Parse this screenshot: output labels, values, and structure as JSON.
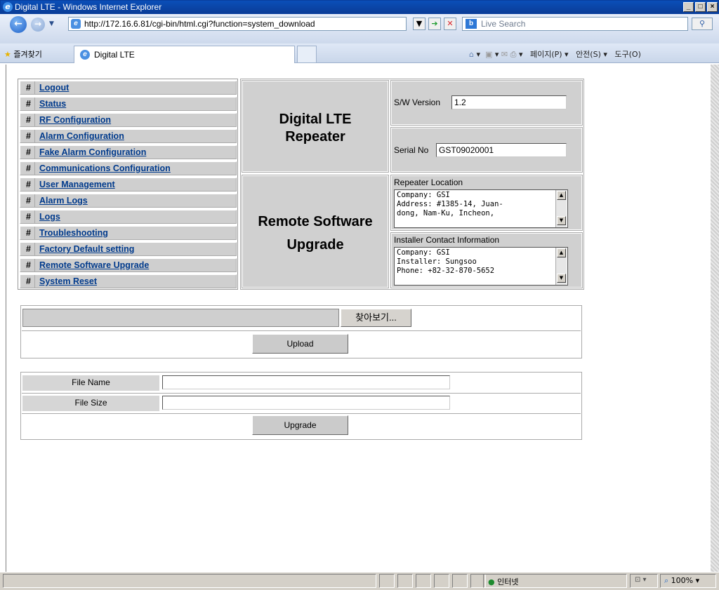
{
  "window": {
    "title": "Digital LTE - Windows Internet Explorer",
    "url": "http://172.16.6.81/cgi-bin/html.cgi?function=system_download",
    "search_placeholder": "Live Search",
    "favorites_label": "즐겨찾기",
    "tab_title": "Digital LTE",
    "toolbar_menus": [
      "페이지(P)",
      "안전(S)",
      "도구(O)"
    ],
    "status_zone": "인터넷",
    "zoom": "100%"
  },
  "menu": {
    "items": [
      "Logout",
      "Status",
      "RF Configuration",
      "Alarm Configuration",
      "Fake Alarm Configuration",
      "Communications Configuration",
      "User Management",
      "Alarm Logs",
      "Logs",
      "Troubleshooting",
      "Factory Default setting",
      "Remote Software Upgrade",
      "System Reset"
    ],
    "marker": "#"
  },
  "header": {
    "product_line1": "Digital LTE",
    "product_line2": "Repeater",
    "page_line1": "Remote Software",
    "page_line2": "Upgrade",
    "sw_version_label": "S/W Version",
    "sw_version_value": "1.2",
    "serial_label": "Serial No",
    "serial_value": "GST09020001",
    "location_label": "Repeater Location",
    "location_text": "Company: GSI\nAddress: #1385-14, Juan-\ndong, Nam-Ku, Incheon,",
    "installer_label": "Installer Contact Information",
    "installer_text": "Company: GSI\nInstaller: Sungsoo\nPhone: +82-32-870-5652"
  },
  "upload": {
    "browse_label": "찾아보기...",
    "upload_label": "Upload"
  },
  "file_info": {
    "name_label": "File Name",
    "name_value": "",
    "size_label": "File Size",
    "size_value": "",
    "upgrade_label": "Upgrade"
  }
}
